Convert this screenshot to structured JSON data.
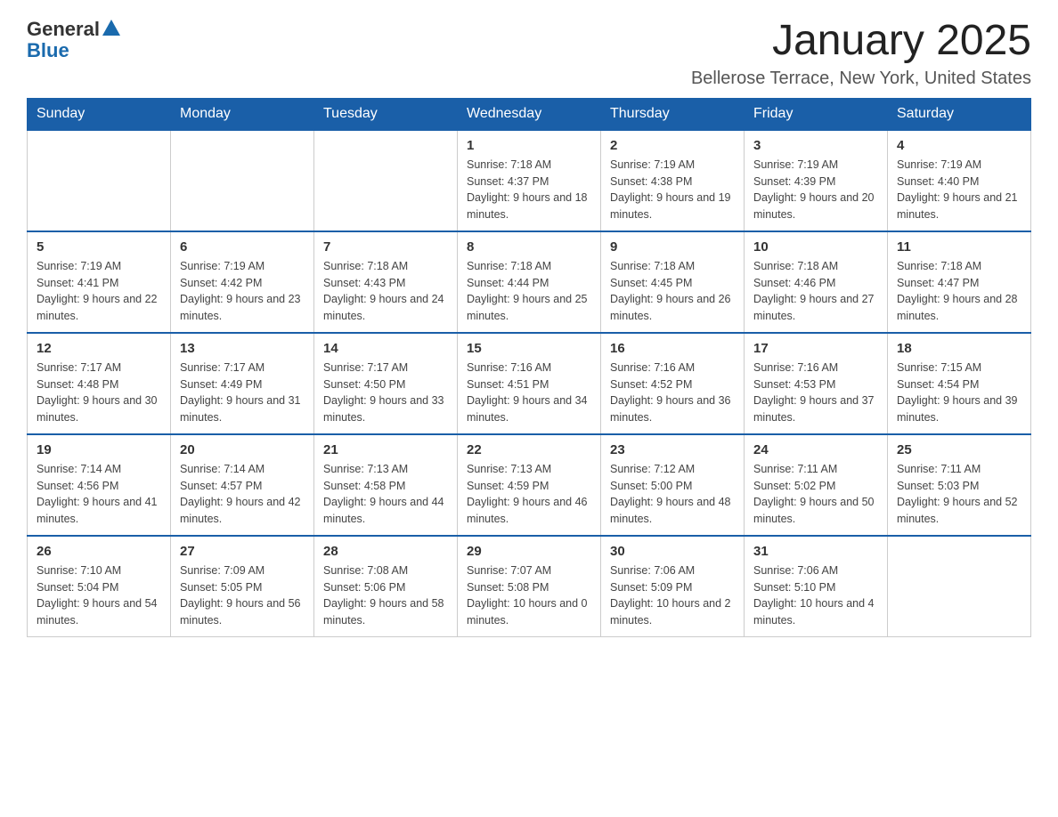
{
  "header": {
    "logo_general": "General",
    "logo_blue": "Blue",
    "month_title": "January 2025",
    "location": "Bellerose Terrace, New York, United States"
  },
  "days_of_week": [
    "Sunday",
    "Monday",
    "Tuesday",
    "Wednesday",
    "Thursday",
    "Friday",
    "Saturday"
  ],
  "weeks": [
    [
      {
        "day": "",
        "info": ""
      },
      {
        "day": "",
        "info": ""
      },
      {
        "day": "",
        "info": ""
      },
      {
        "day": "1",
        "sunrise": "Sunrise: 7:18 AM",
        "sunset": "Sunset: 4:37 PM",
        "daylight": "Daylight: 9 hours and 18 minutes."
      },
      {
        "day": "2",
        "sunrise": "Sunrise: 7:19 AM",
        "sunset": "Sunset: 4:38 PM",
        "daylight": "Daylight: 9 hours and 19 minutes."
      },
      {
        "day": "3",
        "sunrise": "Sunrise: 7:19 AM",
        "sunset": "Sunset: 4:39 PM",
        "daylight": "Daylight: 9 hours and 20 minutes."
      },
      {
        "day": "4",
        "sunrise": "Sunrise: 7:19 AM",
        "sunset": "Sunset: 4:40 PM",
        "daylight": "Daylight: 9 hours and 21 minutes."
      }
    ],
    [
      {
        "day": "5",
        "sunrise": "Sunrise: 7:19 AM",
        "sunset": "Sunset: 4:41 PM",
        "daylight": "Daylight: 9 hours and 22 minutes."
      },
      {
        "day": "6",
        "sunrise": "Sunrise: 7:19 AM",
        "sunset": "Sunset: 4:42 PM",
        "daylight": "Daylight: 9 hours and 23 minutes."
      },
      {
        "day": "7",
        "sunrise": "Sunrise: 7:18 AM",
        "sunset": "Sunset: 4:43 PM",
        "daylight": "Daylight: 9 hours and 24 minutes."
      },
      {
        "day": "8",
        "sunrise": "Sunrise: 7:18 AM",
        "sunset": "Sunset: 4:44 PM",
        "daylight": "Daylight: 9 hours and 25 minutes."
      },
      {
        "day": "9",
        "sunrise": "Sunrise: 7:18 AM",
        "sunset": "Sunset: 4:45 PM",
        "daylight": "Daylight: 9 hours and 26 minutes."
      },
      {
        "day": "10",
        "sunrise": "Sunrise: 7:18 AM",
        "sunset": "Sunset: 4:46 PM",
        "daylight": "Daylight: 9 hours and 27 minutes."
      },
      {
        "day": "11",
        "sunrise": "Sunrise: 7:18 AM",
        "sunset": "Sunset: 4:47 PM",
        "daylight": "Daylight: 9 hours and 28 minutes."
      }
    ],
    [
      {
        "day": "12",
        "sunrise": "Sunrise: 7:17 AM",
        "sunset": "Sunset: 4:48 PM",
        "daylight": "Daylight: 9 hours and 30 minutes."
      },
      {
        "day": "13",
        "sunrise": "Sunrise: 7:17 AM",
        "sunset": "Sunset: 4:49 PM",
        "daylight": "Daylight: 9 hours and 31 minutes."
      },
      {
        "day": "14",
        "sunrise": "Sunrise: 7:17 AM",
        "sunset": "Sunset: 4:50 PM",
        "daylight": "Daylight: 9 hours and 33 minutes."
      },
      {
        "day": "15",
        "sunrise": "Sunrise: 7:16 AM",
        "sunset": "Sunset: 4:51 PM",
        "daylight": "Daylight: 9 hours and 34 minutes."
      },
      {
        "day": "16",
        "sunrise": "Sunrise: 7:16 AM",
        "sunset": "Sunset: 4:52 PM",
        "daylight": "Daylight: 9 hours and 36 minutes."
      },
      {
        "day": "17",
        "sunrise": "Sunrise: 7:16 AM",
        "sunset": "Sunset: 4:53 PM",
        "daylight": "Daylight: 9 hours and 37 minutes."
      },
      {
        "day": "18",
        "sunrise": "Sunrise: 7:15 AM",
        "sunset": "Sunset: 4:54 PM",
        "daylight": "Daylight: 9 hours and 39 minutes."
      }
    ],
    [
      {
        "day": "19",
        "sunrise": "Sunrise: 7:14 AM",
        "sunset": "Sunset: 4:56 PM",
        "daylight": "Daylight: 9 hours and 41 minutes."
      },
      {
        "day": "20",
        "sunrise": "Sunrise: 7:14 AM",
        "sunset": "Sunset: 4:57 PM",
        "daylight": "Daylight: 9 hours and 42 minutes."
      },
      {
        "day": "21",
        "sunrise": "Sunrise: 7:13 AM",
        "sunset": "Sunset: 4:58 PM",
        "daylight": "Daylight: 9 hours and 44 minutes."
      },
      {
        "day": "22",
        "sunrise": "Sunrise: 7:13 AM",
        "sunset": "Sunset: 4:59 PM",
        "daylight": "Daylight: 9 hours and 46 minutes."
      },
      {
        "day": "23",
        "sunrise": "Sunrise: 7:12 AM",
        "sunset": "Sunset: 5:00 PM",
        "daylight": "Daylight: 9 hours and 48 minutes."
      },
      {
        "day": "24",
        "sunrise": "Sunrise: 7:11 AM",
        "sunset": "Sunset: 5:02 PM",
        "daylight": "Daylight: 9 hours and 50 minutes."
      },
      {
        "day": "25",
        "sunrise": "Sunrise: 7:11 AM",
        "sunset": "Sunset: 5:03 PM",
        "daylight": "Daylight: 9 hours and 52 minutes."
      }
    ],
    [
      {
        "day": "26",
        "sunrise": "Sunrise: 7:10 AM",
        "sunset": "Sunset: 5:04 PM",
        "daylight": "Daylight: 9 hours and 54 minutes."
      },
      {
        "day": "27",
        "sunrise": "Sunrise: 7:09 AM",
        "sunset": "Sunset: 5:05 PM",
        "daylight": "Daylight: 9 hours and 56 minutes."
      },
      {
        "day": "28",
        "sunrise": "Sunrise: 7:08 AM",
        "sunset": "Sunset: 5:06 PM",
        "daylight": "Daylight: 9 hours and 58 minutes."
      },
      {
        "day": "29",
        "sunrise": "Sunrise: 7:07 AM",
        "sunset": "Sunset: 5:08 PM",
        "daylight": "Daylight: 10 hours and 0 minutes."
      },
      {
        "day": "30",
        "sunrise": "Sunrise: 7:06 AM",
        "sunset": "Sunset: 5:09 PM",
        "daylight": "Daylight: 10 hours and 2 minutes."
      },
      {
        "day": "31",
        "sunrise": "Sunrise: 7:06 AM",
        "sunset": "Sunset: 5:10 PM",
        "daylight": "Daylight: 10 hours and 4 minutes."
      },
      {
        "day": "",
        "info": ""
      }
    ]
  ]
}
